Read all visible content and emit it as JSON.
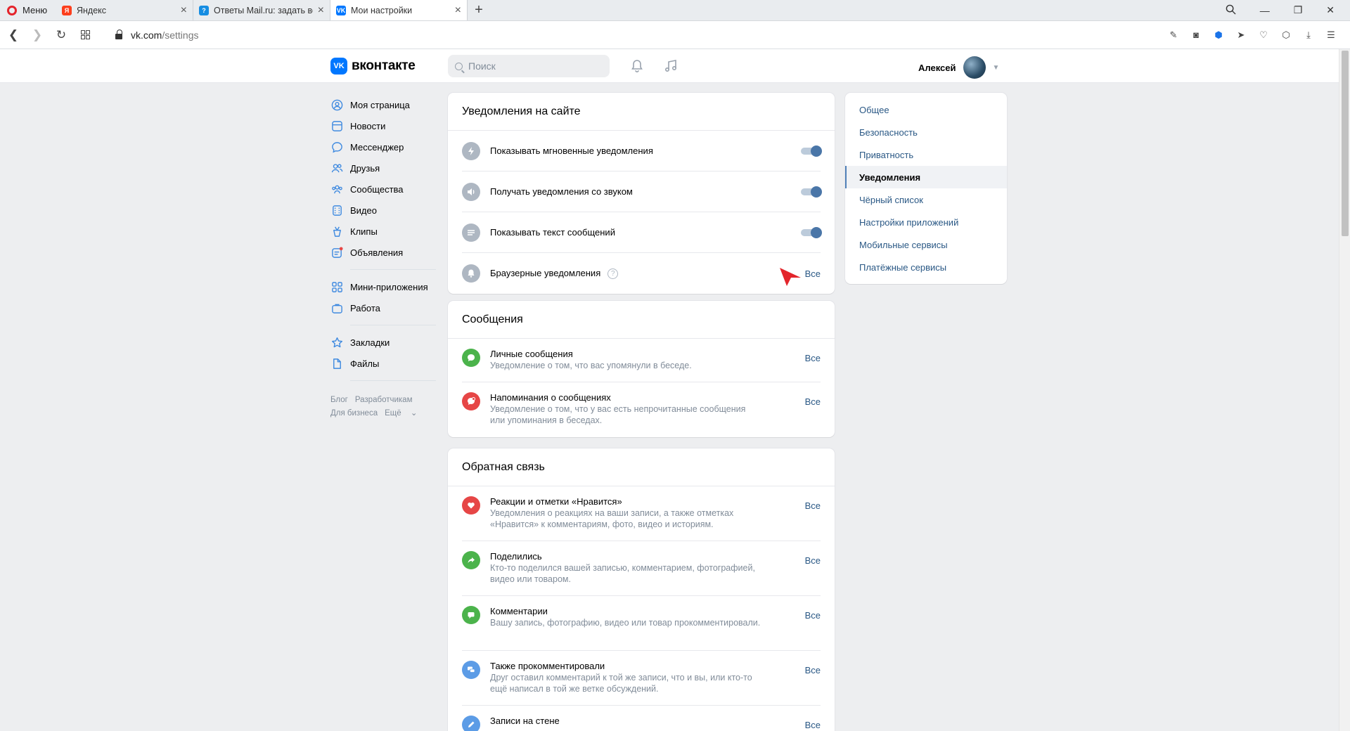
{
  "browser": {
    "menu_label": "Меню",
    "tabs": [
      {
        "title": "Яндекс",
        "favicon": "yandex-icon"
      },
      {
        "title": "Ответы Mail.ru: задать воп",
        "favicon": "mailru-icon"
      },
      {
        "title": "Мои настройки",
        "favicon": "vk-icon"
      }
    ],
    "url_host": "vk.com",
    "url_path": "/settings"
  },
  "header": {
    "logo_text": "вконтакте",
    "search_placeholder": "Поиск",
    "user_name": "Алексей"
  },
  "left_nav": {
    "items": [
      {
        "label": "Моя страница",
        "icon": "profile-icon"
      },
      {
        "label": "Новости",
        "icon": "news-icon"
      },
      {
        "label": "Мессенджер",
        "icon": "messenger-icon"
      },
      {
        "label": "Друзья",
        "icon": "friends-icon"
      },
      {
        "label": "Сообщества",
        "icon": "communities-icon"
      },
      {
        "label": "Видео",
        "icon": "video-icon"
      },
      {
        "label": "Клипы",
        "icon": "clips-icon"
      },
      {
        "label": "Объявления",
        "icon": "ads-icon"
      }
    ],
    "items2": [
      {
        "label": "Мини-приложения",
        "icon": "apps-icon"
      },
      {
        "label": "Работа",
        "icon": "work-icon"
      }
    ],
    "items3": [
      {
        "label": "Закладки",
        "icon": "bookmarks-icon"
      },
      {
        "label": "Файлы",
        "icon": "files-icon"
      }
    ],
    "footer": {
      "blog": "Блог",
      "devs": "Разработчикам",
      "business": "Для бизнеса",
      "more": "Ещё"
    }
  },
  "site_notifications": {
    "title": "Уведомления на сайте",
    "rows": [
      {
        "label": "Показывать мгновенные уведомления",
        "icon": "lightning-icon",
        "toggle": true
      },
      {
        "label": "Получать уведомления со звуком",
        "icon": "sound-icon",
        "toggle": true
      },
      {
        "label": "Показывать текст сообщений",
        "icon": "text-lines-icon",
        "toggle": true
      },
      {
        "label": "Браузерные уведомления",
        "icon": "bell-icon",
        "value": "Все"
      }
    ]
  },
  "messages": {
    "title": "Сообщения",
    "rows": [
      {
        "label": "Личные сообщения",
        "desc": "Уведомление о том, что вас упомянули в беседе.",
        "value": "Все",
        "icon": "message-bubble-icon",
        "color": "#4bb34b"
      },
      {
        "label": "Напоминания о сообщениях",
        "desc": "Уведомление о том, что у вас есть непрочитанные сообщения или упоминания в беседах.",
        "value": "Все",
        "icon": "reminder-icon",
        "color": "#e64646"
      }
    ]
  },
  "feedback": {
    "title": "Обратная связь",
    "rows": [
      {
        "label": "Реакции и отметки «Нравится»",
        "desc": "Уведомления о реакциях на ваши записи, а также отметках «Нравится» к комментариям, фото, видео и историям.",
        "value": "Все",
        "icon": "heart-icon",
        "color": "#e64646"
      },
      {
        "label": "Поделились",
        "desc": "Кто-то поделился вашей записью, комментарием, фотографией, видео или товаром.",
        "value": "Все",
        "icon": "share-icon",
        "color": "#4bb34b"
      },
      {
        "label": "Комментарии",
        "desc": "Вашу запись, фотографию, видео или товар прокомментировали.",
        "value": "Все",
        "icon": "comment-icon",
        "color": "#4bb34b"
      },
      {
        "label": "Также прокомментировали",
        "desc": "Друг оставил комментарий к той же записи, что и вы, или кто-то ещё написал в той же ветке обсуждений.",
        "value": "Все",
        "icon": "comments-icon",
        "color": "#5c9ce6"
      },
      {
        "label": "Записи на стене",
        "desc": "",
        "value": "Все",
        "icon": "pencil-icon",
        "color": "#5c9ce6"
      }
    ]
  },
  "right_menu": {
    "items": [
      "Общее",
      "Безопасность",
      "Приватность",
      "Уведомления",
      "Чёрный список",
      "Настройки приложений",
      "Мобильные сервисы",
      "Платёжные сервисы"
    ],
    "active_index": 3
  }
}
